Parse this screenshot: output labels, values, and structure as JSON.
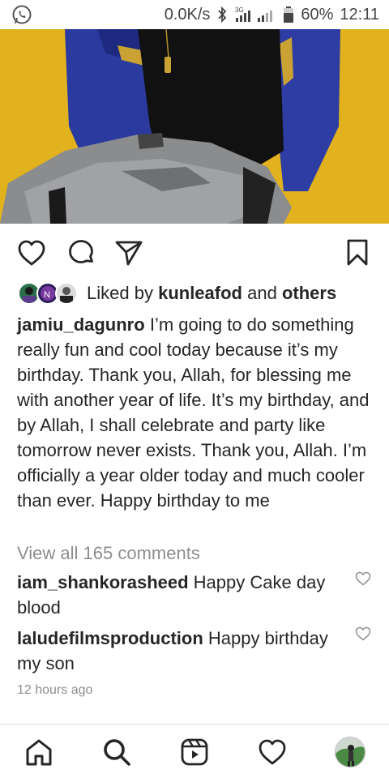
{
  "status_bar": {
    "speed": "0.0K/s",
    "network": "3G",
    "battery": "60%",
    "time": "12:11"
  },
  "post": {
    "image_icon": "post-photo",
    "actions": {
      "like_icon": "heart-icon",
      "comment_icon": "comment-icon",
      "share_icon": "send-icon",
      "save_icon": "bookmark-icon"
    },
    "likes": {
      "prefix": "Liked by",
      "user": "kunleafod",
      "and": "and",
      "others": "others"
    },
    "caption": {
      "username": "jamiu_dagunro",
      "text": "I’m going to do something really fun and cool today because it’s my birthday. Thank you, Allah, for blessing me with another year of life. It’s my birthday, and by Allah, I shall celebrate and party like tomorrow never exists. Thank you, Allah. I’m officially a year older today and much cooler than ever. Happy birthday to me"
    },
    "view_all_comments": "View all 165 comments",
    "comments": [
      {
        "username": "iam_shankorasheed",
        "text": "Happy Cake day blood"
      },
      {
        "username": "laludefilmsproduction",
        "text": "Happy birthday my son"
      }
    ],
    "time_ago": "12 hours ago"
  },
  "bottom_nav": {
    "items": [
      "home-icon",
      "search-icon",
      "reels-icon",
      "activity-heart-icon",
      "profile-avatar"
    ]
  }
}
